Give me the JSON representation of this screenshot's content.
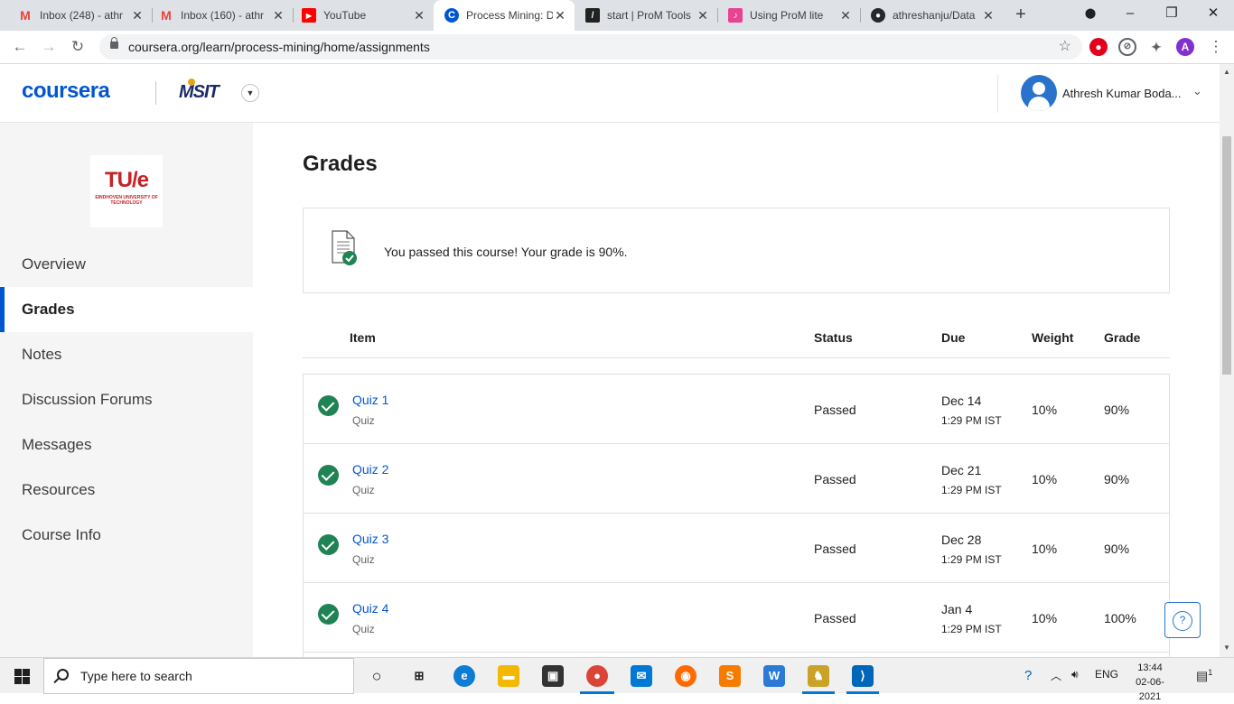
{
  "browser": {
    "tabs": [
      {
        "title": "Inbox (248) - athr",
        "icon": "gmail-icon",
        "color": "#ea4335"
      },
      {
        "title": "Inbox (160) - athr",
        "icon": "gmail-icon",
        "color": "#ea4335"
      },
      {
        "title": "YouTube",
        "icon": "youtube-icon",
        "color": "#ff0000"
      },
      {
        "title": "Process Mining: D",
        "icon": "coursera-icon",
        "color": "#0056d2"
      },
      {
        "title": "start | ProM Tools",
        "icon": "prom-icon",
        "color": "#222222"
      },
      {
        "title": "Using ProM lite",
        "icon": "prom-lite-icon",
        "color": "#e84393"
      },
      {
        "title": "athreshanju/Data",
        "icon": "github-icon",
        "color": "#24292e"
      }
    ],
    "new_tab": "+",
    "url": "coursera.org/learn/process-mining/home/assignments",
    "profile_initial": "A"
  },
  "header": {
    "brand": "coursera",
    "partner": "MSIT",
    "user_name": "Athresh Kumar Boda..."
  },
  "sidebar": {
    "university_logo": "TU/e",
    "university_name": "EINDHOVEN UNIVERSITY OF TECHNOLOGY",
    "items": [
      {
        "label": "Overview"
      },
      {
        "label": "Grades"
      },
      {
        "label": "Notes"
      },
      {
        "label": "Discussion Forums"
      },
      {
        "label": "Messages"
      },
      {
        "label": "Resources"
      },
      {
        "label": "Course Info"
      }
    ],
    "active": "Grades"
  },
  "main": {
    "title": "Grades",
    "pass_message": "You passed this course! Your grade is 90%.",
    "columns": {
      "item": "Item",
      "status": "Status",
      "due": "Due",
      "weight": "Weight",
      "grade": "Grade"
    },
    "rows": [
      {
        "name": "Quiz 1",
        "type": "Quiz",
        "status": "Passed",
        "due": "Dec 14",
        "time": "1:29 PM IST",
        "weight": "10%",
        "grade": "90%"
      },
      {
        "name": "Quiz 2",
        "type": "Quiz",
        "status": "Passed",
        "due": "Dec 21",
        "time": "1:29 PM IST",
        "weight": "10%",
        "grade": "90%"
      },
      {
        "name": "Quiz 3",
        "type": "Quiz",
        "status": "Passed",
        "due": "Dec 28",
        "time": "1:29 PM IST",
        "weight": "10%",
        "grade": "90%"
      },
      {
        "name": "Quiz 4",
        "type": "Quiz",
        "status": "Passed",
        "due": "Jan 4",
        "time": "1:29 PM IST",
        "weight": "10%",
        "grade": "100%"
      }
    ],
    "help": "?"
  },
  "taskbar": {
    "search_placeholder": "Type here to search",
    "language": "ENG",
    "time": "13:44",
    "date": "02-06-2021",
    "notification_count": "1"
  },
  "colors": {
    "brand": "#0056d2",
    "passed": "#1f8354",
    "university": "#c72125"
  }
}
